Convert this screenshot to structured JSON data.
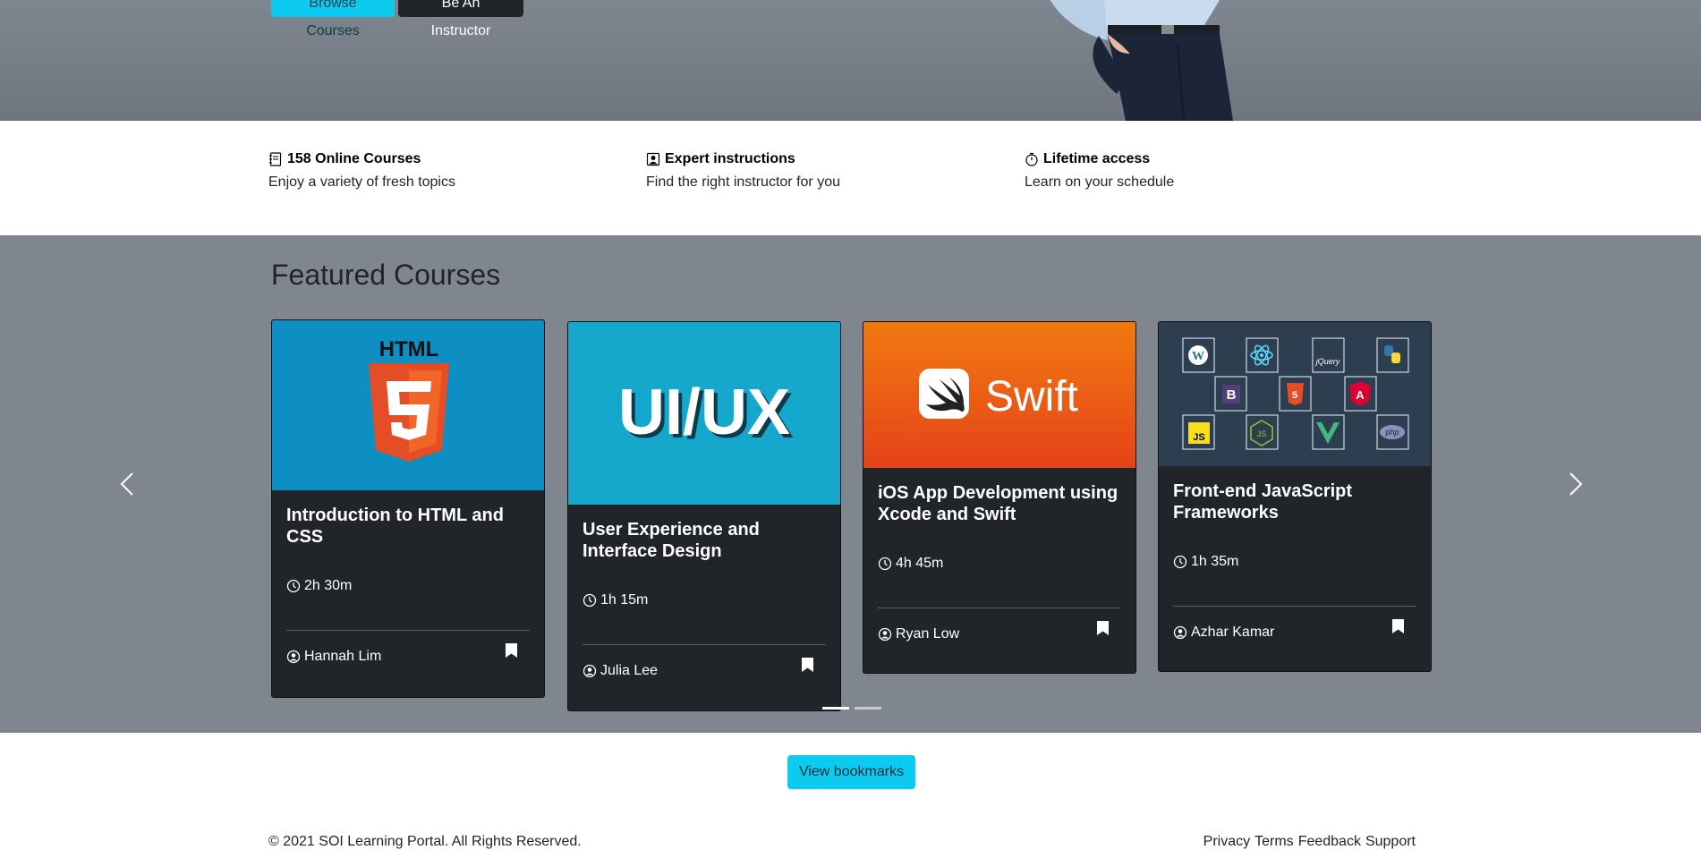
{
  "hero": {
    "browse_label": "Browse Courses",
    "instructor_label": "Be An Instructor"
  },
  "features": [
    {
      "icon": "journal-icon",
      "title": "158 Online Courses",
      "subtitle": "Enjoy a variety of fresh topics"
    },
    {
      "icon": "person-badge-icon",
      "title": "Expert instructions",
      "subtitle": "Find the right instructor for you"
    },
    {
      "icon": "stopwatch-icon",
      "title": "Lifetime access",
      "subtitle": "Learn on your schedule"
    }
  ],
  "featured": {
    "heading": "Featured Courses",
    "courses": [
      {
        "title": "Introduction to HTML and CSS",
        "image_text": "HTML",
        "duration": "2h 30m",
        "author": "Hannah Lim",
        "image_color": "#0e8fc4"
      },
      {
        "title": "User Experience and Interface Design",
        "image_text": "UI/UX",
        "duration": "1h 15m",
        "author": "Julia Lee",
        "image_color": "#16a8cc"
      },
      {
        "title": "iOS App Development using Xcode and Swift",
        "image_text": "Swift",
        "duration": "4h 45m",
        "author": "Ryan Low",
        "image_color": "#f0620f"
      },
      {
        "title": "Front-end JavaScript Frameworks",
        "image_text": "",
        "duration": "1h 35m",
        "author": "Azhar Kamar",
        "image_color": "#2d3e50"
      }
    ],
    "logo_tiles": [
      "W",
      "⚛",
      "jQuery",
      "🐍",
      "B",
      "5",
      "A",
      "JS",
      "JS",
      "V",
      "php"
    ]
  },
  "bookmarks_label": "View bookmarks",
  "footer": {
    "copyright": "© 2021 SOI Learning Portal. All Rights Reserved.",
    "links": [
      "Privacy",
      "Terms",
      "Feedback",
      "Support"
    ]
  },
  "colors": {
    "accent": "#0dcaf0",
    "dark": "#212529",
    "section_bg": "#7f868f"
  }
}
